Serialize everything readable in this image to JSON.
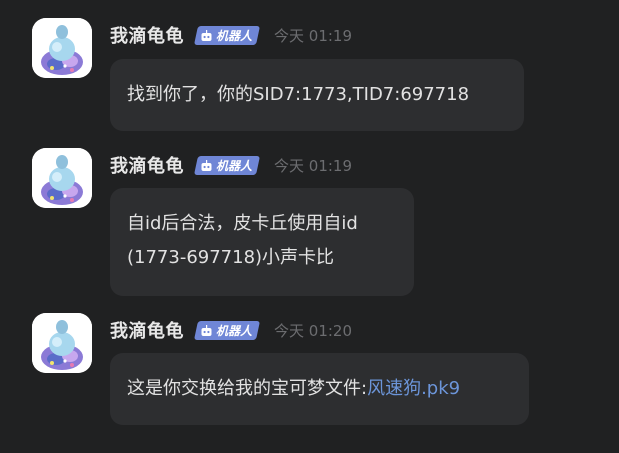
{
  "messages": [
    {
      "sender": "我滴龟龟",
      "badge": "机器人",
      "time": "今天 01:19",
      "text": "找到你了，你的SID7:1773,TID7:697718"
    },
    {
      "sender": "我滴龟龟",
      "badge": "机器人",
      "time": "今天 01:19",
      "line1": "自id后合法，皮卡丘使用自id",
      "line2": "(1773-697718)小声卡比"
    },
    {
      "sender": "我滴龟龟",
      "badge": "机器人",
      "time": "今天 01:20",
      "text": "这是你交换给我的宝可梦文件:",
      "file_link": "风速狗.pk9"
    }
  ],
  "icons": {
    "avatar": "avatar-image",
    "badge": "robot-icon"
  },
  "colors": {
    "background": "#202122",
    "bubble": "#2d2e30",
    "badge": "#6f86d6",
    "link": "#6c95d9",
    "time": "#6c6d70"
  }
}
